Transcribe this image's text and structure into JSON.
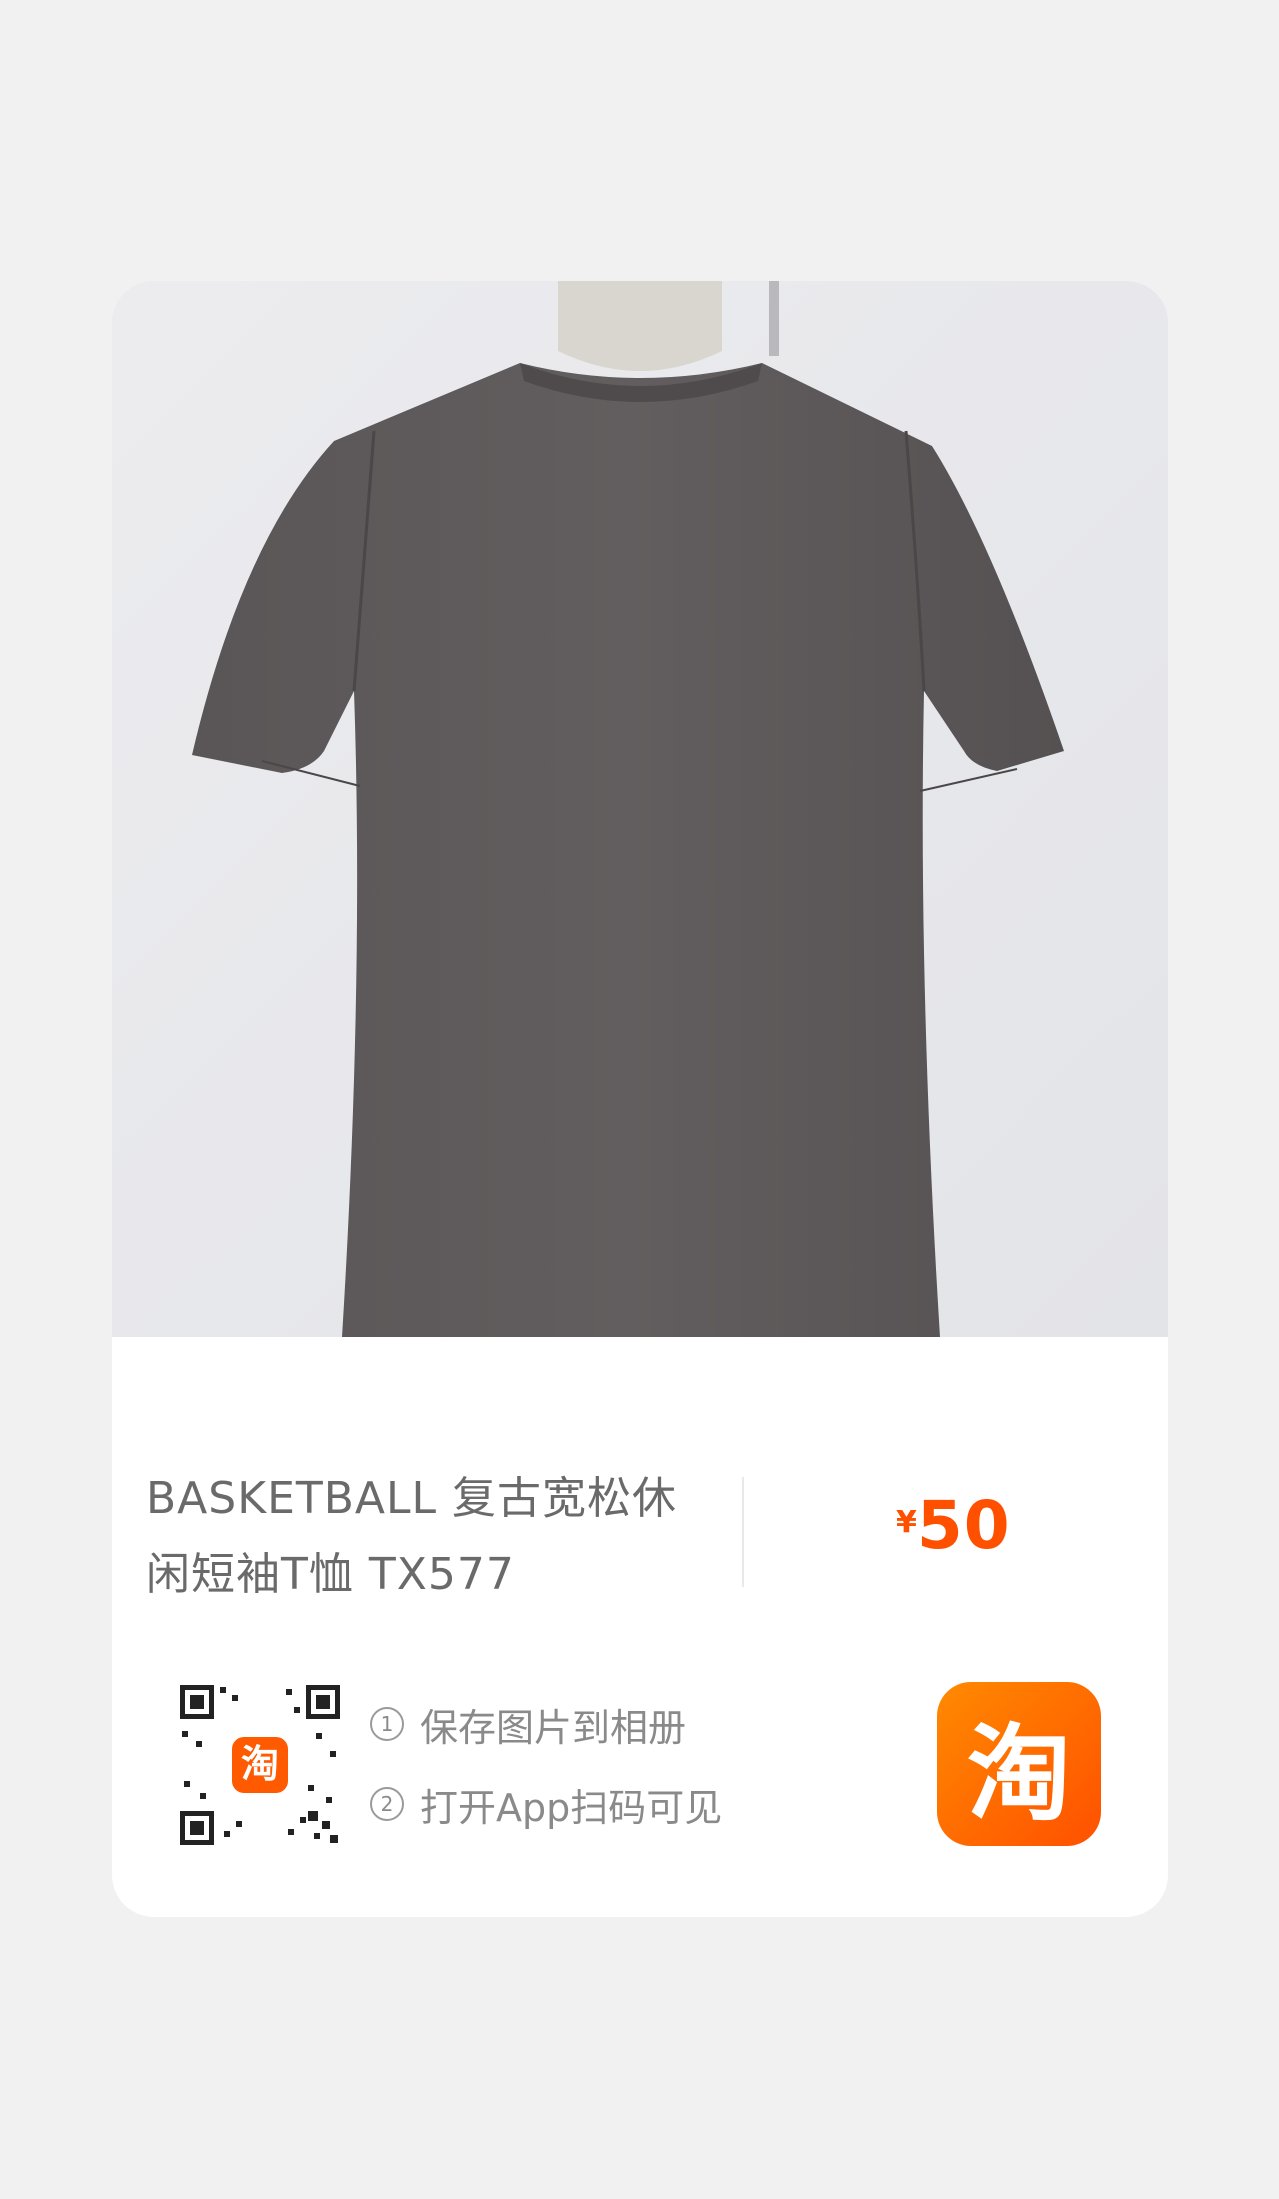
{
  "product": {
    "title": "BASKETBALL 复古宽松休闲短袖T恤 TX577",
    "currency": "¥",
    "price": "50"
  },
  "scan_steps": [
    {
      "num": "1",
      "text": "保存图片到相册"
    },
    {
      "num": "2",
      "text": "打开App扫码可见"
    }
  ],
  "logo": {
    "glyph": "淘",
    "qr_badge_glyph": "淘"
  },
  "colors": {
    "accent": "#ff5000",
    "shirt": "#5c5859",
    "background": "#f1f1f1"
  },
  "icons": {
    "qr": "qr-code-icon",
    "app": "taobao-logo-icon"
  }
}
